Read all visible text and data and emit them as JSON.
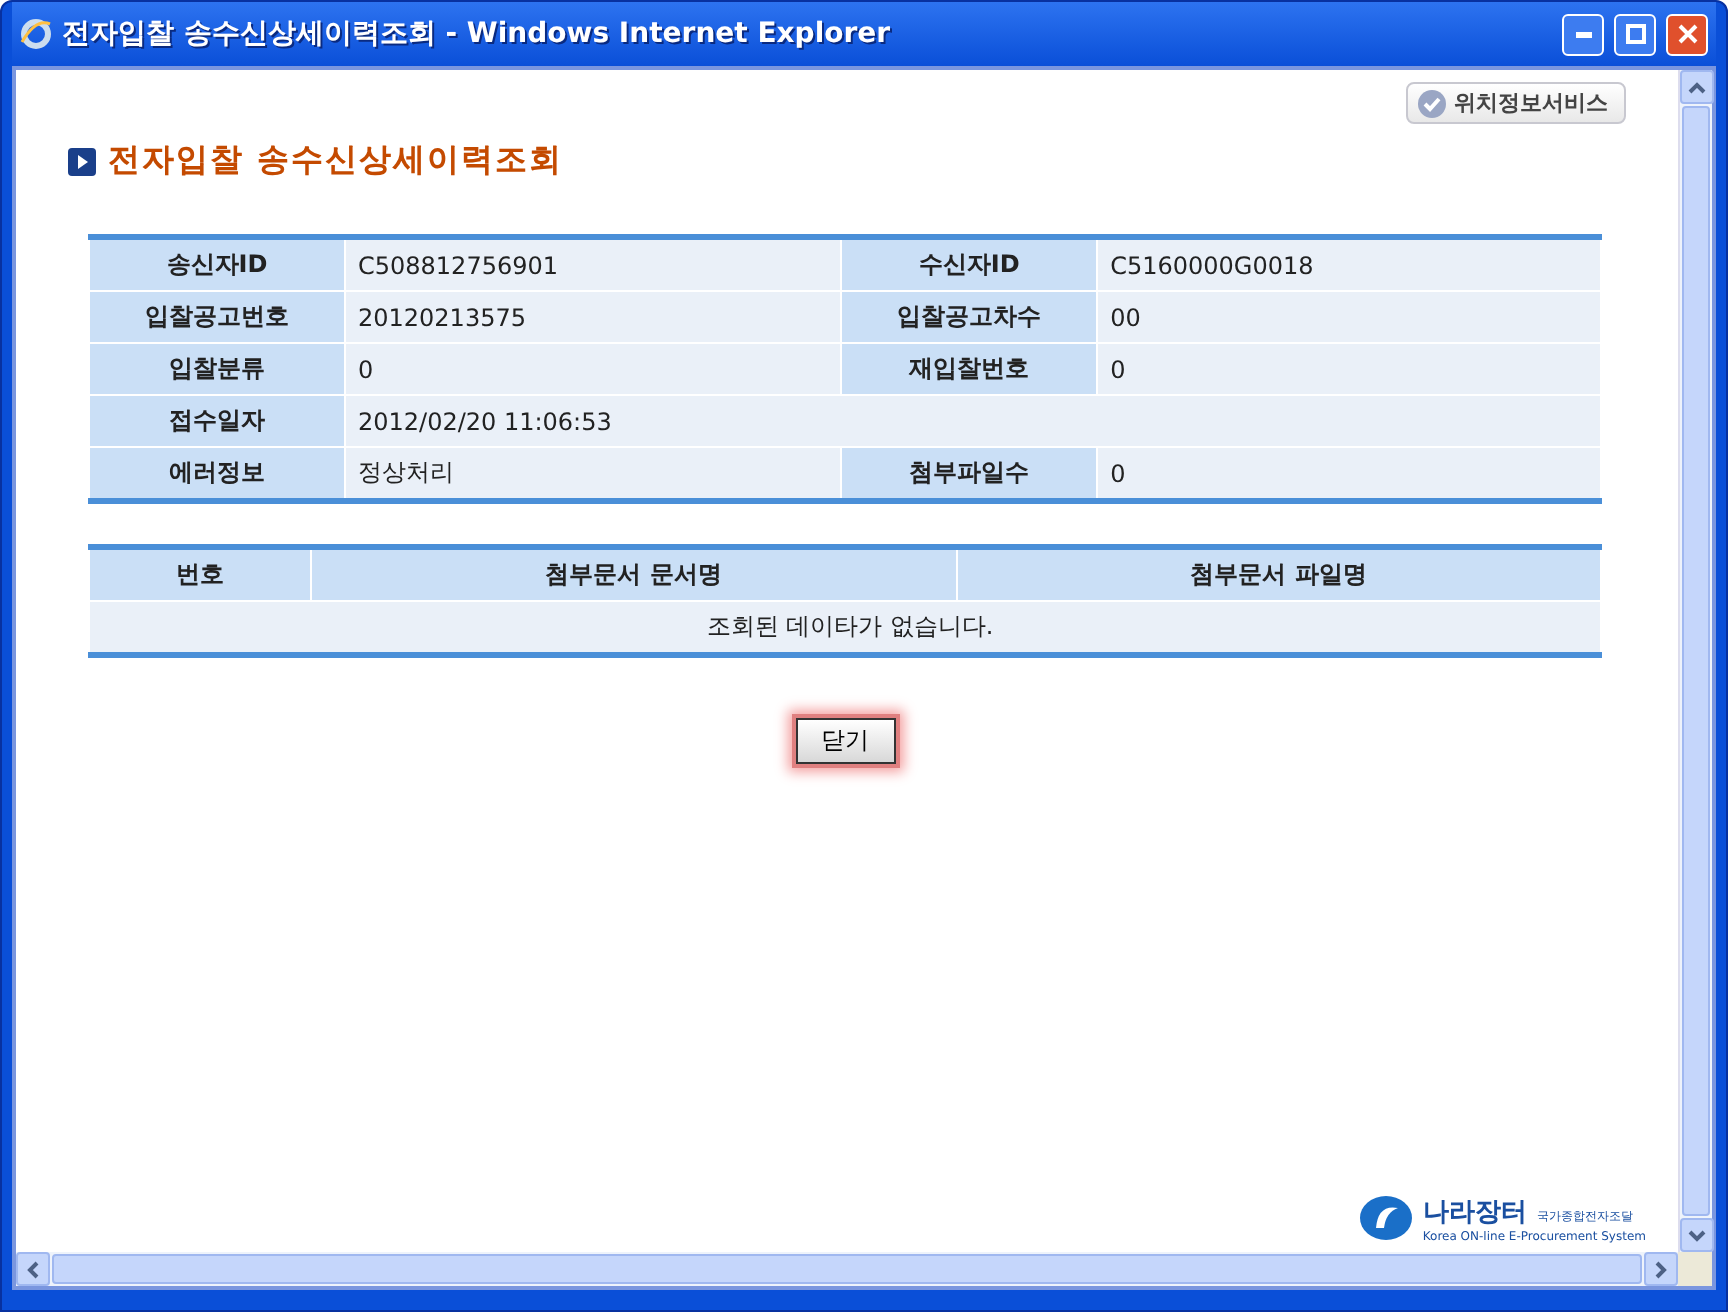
{
  "window": {
    "title": "전자입찰 송수신상세이력조회 - Windows Internet Explorer"
  },
  "location_button": "위치정보서비스",
  "page_title": "전자입찰 송수신상세이력조회",
  "info_table": {
    "rows": [
      [
        {
          "label": "송신자ID",
          "value": "C508812756901"
        },
        {
          "label": "수신자ID",
          "value": "C5160000G0018"
        }
      ],
      [
        {
          "label": "입찰공고번호",
          "value": "20120213575"
        },
        {
          "label": "입찰공고차수",
          "value": "00"
        }
      ],
      [
        {
          "label": "입찰분류",
          "value": "0"
        },
        {
          "label": "재입찰번호",
          "value": "0"
        }
      ],
      [
        {
          "label": "접수일자",
          "value": "2012/02/20 11:06:53"
        }
      ],
      [
        {
          "label": "에러정보",
          "value": "정상처리"
        },
        {
          "label": "첨부파일수",
          "value": "0"
        }
      ]
    ]
  },
  "attachments_table": {
    "columns": [
      "번호",
      "첨부문서 문서명",
      "첨부문서 파일명"
    ],
    "empty_message": "조회된 데이타가 없습니다."
  },
  "close_button": "닫기",
  "logo": {
    "name": "나라장터",
    "subtitle": "국가종합전자조달",
    "tagline": "Korea ON-line E-Procurement System"
  }
}
